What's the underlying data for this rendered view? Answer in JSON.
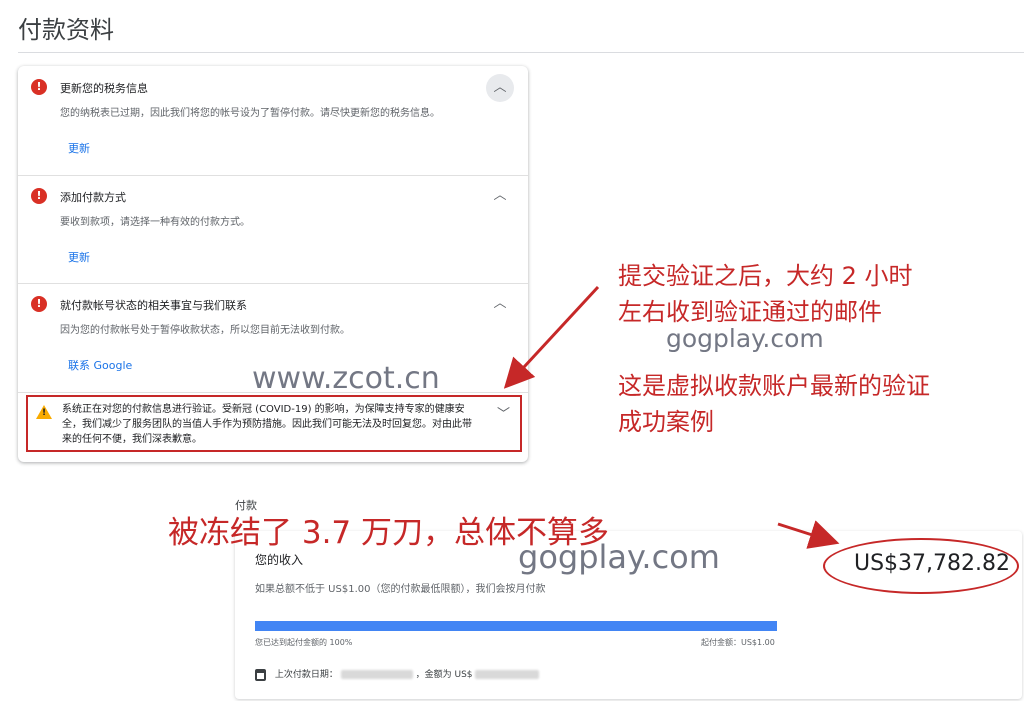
{
  "page": {
    "title": "付款资料"
  },
  "notices": [
    {
      "title": "更新您的税务信息",
      "text": "您的纳税表已过期，因此我们将您的帐号设为了暂停付款。请尽快更新您的税务信息。",
      "link": "更新"
    },
    {
      "title": "添加付款方式",
      "text": "要收到款项，请选择一种有效的付款方式。",
      "link": "更新"
    },
    {
      "title": "就付款帐号状态的相关事宜与我们联系",
      "text": "因为您的付款帐号处于暂停收款状态，所以您目前无法收到付款。",
      "link": "联系 Google"
    }
  ],
  "warning": {
    "text": "系统正在对您的付款信息进行验证。受新冠 (COVID-19) 的影响，为保障支持专家的健康安全，我们减少了服务团队的当值人手作为预防措施。因此我们可能无法及时回复您。对由此带来的任何不便，我们深表歉意。"
  },
  "payments": {
    "section_label": "付款",
    "earnings_title": "您的收入",
    "amount": "US$37,782.82",
    "threshold_note": "如果总额不低于 US$1.00（您的付款最低限额），我们会按月付款",
    "progress_fraction": 1.0,
    "progress_left": "您已达到起付金额的 100%",
    "progress_right": "起付金额：US$1.00",
    "last_payment_label": "上次付款日期：",
    "last_payment_amount_label": "，金额为 US$"
  },
  "annotations": {
    "verify_note_1": "提交验证之后，大约 2 小时",
    "verify_note_2": "左右收到验证通过的邮件",
    "watermark_1": "gogplay.com",
    "case_note_1": "这是虚拟收款账户最新的验证",
    "case_note_2": "成功案例",
    "watermark_site": "www.zcot.cn",
    "frozen_note": "被冻结了 3.7 万刀，总体不算多",
    "watermark_2": "gogplay.com"
  },
  "colors": {
    "error": "#d93025",
    "warning": "#f9ab00",
    "link": "#1a73e8",
    "progress": "#4285f4",
    "annotation": "#c62828"
  }
}
